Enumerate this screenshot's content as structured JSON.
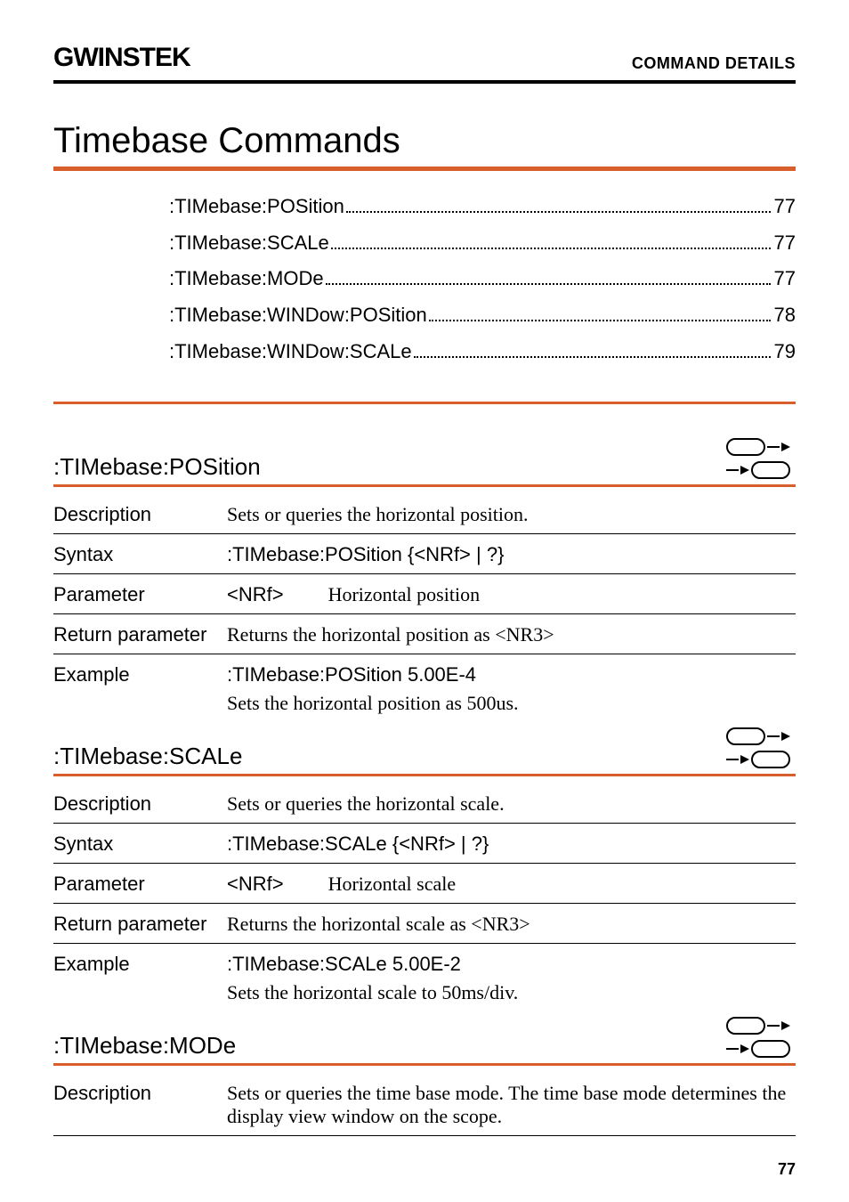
{
  "header": {
    "logo": "GWINSTEK",
    "right": "COMMAND DETAILS"
  },
  "title": "Timebase Commands",
  "toc": [
    {
      "label": ":TIMebase:POSition",
      "page": "77"
    },
    {
      "label": ":TIMebase:SCALe",
      "page": "77"
    },
    {
      "label": ":TIMebase:MODe",
      "page": "77"
    },
    {
      "label": ":TIMebase:WINDow:POSition",
      "page": "78"
    },
    {
      "label": ":TIMebase:WINDow:SCALe",
      "page": "79"
    }
  ],
  "sections": {
    "position": {
      "title": ":TIMebase:POSition",
      "description_label": "Description",
      "description_value": "Sets or queries the horizontal position.",
      "syntax_label": "Syntax",
      "syntax_value": ":TIMebase:POSition {<NRf> | ?}",
      "parameter_label": "Parameter",
      "parameter_key": "<NRf>",
      "parameter_desc": "Horizontal position",
      "return_label": "Return parameter",
      "return_value": "Returns the horizontal position as <NR3>",
      "example_label": "Example",
      "example_cmd": ":TIMebase:POSition 5.00E-4",
      "example_desc": "Sets the horizontal position as 500us."
    },
    "scale": {
      "title": ":TIMebase:SCALe",
      "description_label": "Description",
      "description_value": "Sets or queries the horizontal scale.",
      "syntax_label": "Syntax",
      "syntax_value": ":TIMebase:SCALe {<NRf> | ?}",
      "parameter_label": "Parameter",
      "parameter_key": "<NRf>",
      "parameter_desc": "Horizontal scale",
      "return_label": "Return parameter",
      "return_value": "Returns the horizontal scale as <NR3>",
      "example_label": "Example",
      "example_cmd": ":TIMebase:SCALe 5.00E-2",
      "example_desc": "Sets the horizontal scale to 50ms/div."
    },
    "mode": {
      "title": ":TIMebase:MODe",
      "description_label": "Description",
      "description_value": "Sets or queries the time base mode. The time base mode determines the display view window on the scope."
    }
  },
  "page_number": "77"
}
